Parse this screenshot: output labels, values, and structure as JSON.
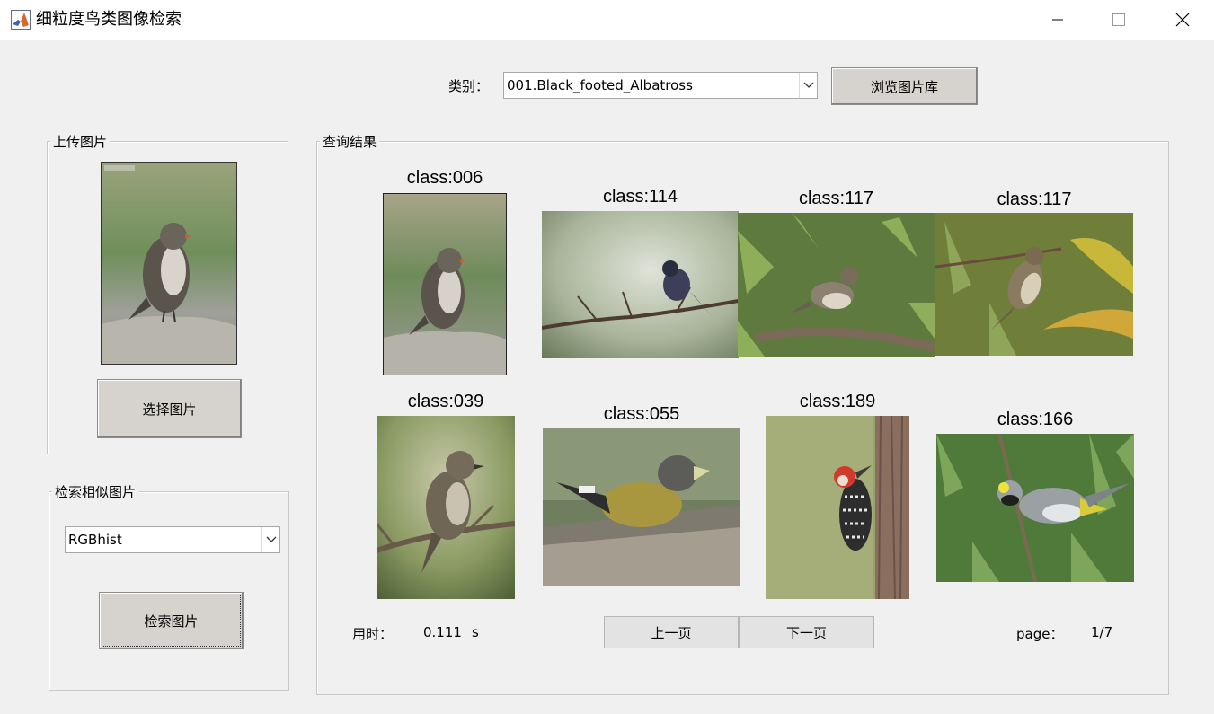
{
  "window": {
    "title": "细粒度鸟类图像检索"
  },
  "category": {
    "label": "类别：",
    "selected": "001.Black_footed_Albatross",
    "browse_button": "浏览图片库"
  },
  "upload_panel": {
    "title": "上传图片",
    "select_button": "选择图片"
  },
  "search_panel": {
    "title": "检索相似图片",
    "method_selected": "RGBhist",
    "search_button": "检索图片"
  },
  "results_panel": {
    "title": "查询结果",
    "results": [
      {
        "label": "class:006"
      },
      {
        "label": "class:114"
      },
      {
        "label": "class:117"
      },
      {
        "label": "class:117"
      },
      {
        "label": "class:039"
      },
      {
        "label": "class:055"
      },
      {
        "label": "class:189"
      },
      {
        "label": "class:166"
      }
    ],
    "time_label": "用时：",
    "time_value": "0.111",
    "time_unit": "s",
    "prev_button": "上一页",
    "next_button": "下一页",
    "page_label": "page：",
    "page_value": "1/7"
  },
  "icons": {
    "app": "matlab-icon",
    "minimize": "minimize-icon",
    "maximize": "maximize-icon",
    "close": "close-icon",
    "dropdown": "chevron-down-icon"
  }
}
